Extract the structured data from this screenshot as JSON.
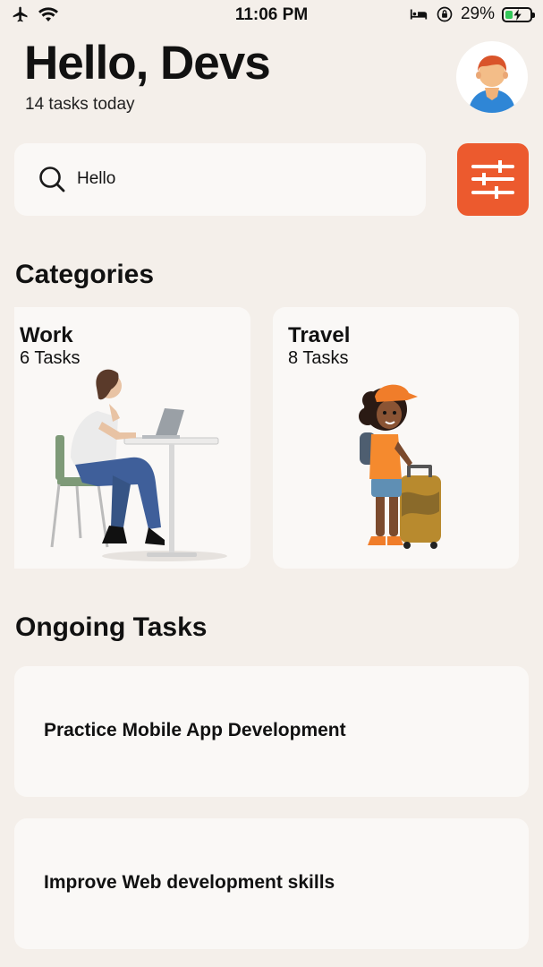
{
  "status_bar": {
    "time": "11:06 PM",
    "battery": "29%",
    "battery_level": 0.29,
    "icons": [
      "airplane-icon",
      "wifi-icon",
      "bed-icon",
      "orientation-lock-icon",
      "battery-charging-icon"
    ]
  },
  "header": {
    "greeting": "Hello, Devs",
    "subtitle": "14 tasks today"
  },
  "search": {
    "value": "Hello",
    "icon": "search-icon"
  },
  "filter": {
    "icon": "sliders-icon",
    "color": "#ec5a2e"
  },
  "categories": {
    "title": "Categories",
    "items": [
      {
        "title": "Work",
        "count": "6 Tasks",
        "illustration": "woman-at-desk-illustration"
      },
      {
        "title": "Travel",
        "count": "8 Tasks",
        "illustration": "traveler-with-suitcase-illustration"
      }
    ]
  },
  "ongoing": {
    "title": "Ongoing Tasks",
    "items": [
      {
        "label": "Practice Mobile App Development"
      },
      {
        "label": "Improve Web development skills"
      }
    ]
  },
  "colors": {
    "background": "#f4efea",
    "card": "#faf8f6",
    "accent": "#ec5a2e"
  }
}
